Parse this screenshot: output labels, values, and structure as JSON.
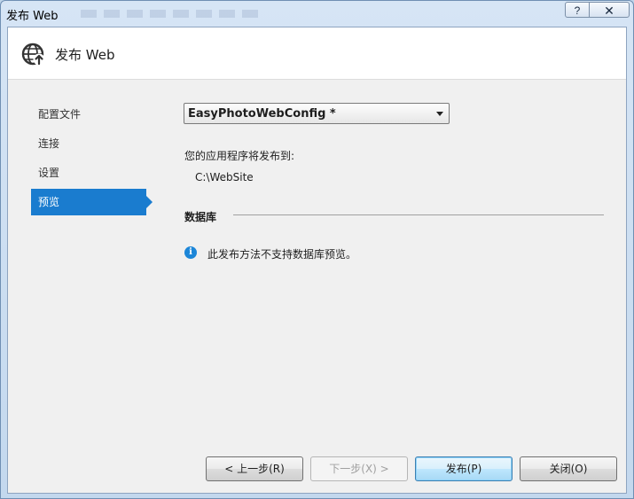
{
  "window": {
    "title": "发布 Web",
    "help_label": "?",
    "close_label": "✕"
  },
  "header": {
    "title": "发布 Web",
    "icon": "globe-publish-icon"
  },
  "nav": {
    "items": [
      {
        "label": "配置文件"
      },
      {
        "label": "连接"
      },
      {
        "label": "设置"
      },
      {
        "label": "预览"
      }
    ],
    "active_index": 3
  },
  "main": {
    "profile_selected": "EasyPhotoWebConfig *",
    "publish_label": "您的应用程序将发布到:",
    "publish_target": "C:\\WebSite",
    "database_section_title": "数据库",
    "info_icon": "info-icon",
    "info_text": "此发布方法不支持数据库预览。"
  },
  "footer": {
    "prev_label": "< 上一步(R)",
    "next_label": "下一步(X) >",
    "publish_label": "发布(P)",
    "close_label": "关闭(O)"
  },
  "colors": {
    "accent": "#1a7ccf",
    "info": "#1c86d8"
  }
}
